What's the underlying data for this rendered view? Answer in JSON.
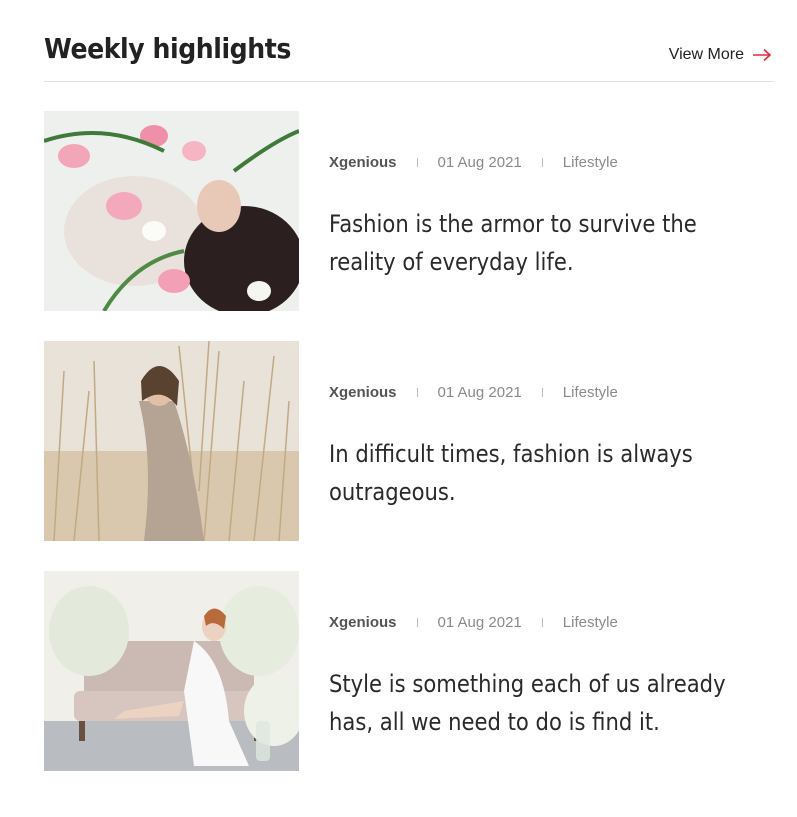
{
  "header": {
    "title": "Weekly highlights",
    "view_more_label": "View More",
    "accent_color": "#e02b3c"
  },
  "posts": [
    {
      "author": "Xgenious",
      "date": "01 Aug 2021",
      "category": "Lifestyle",
      "title": "Fashion is the armor to survive the reality of everyday life.",
      "image_icon": "woman-with-pink-flowers-photo"
    },
    {
      "author": "Xgenious",
      "date": "01 Aug 2021",
      "category": "Lifestyle",
      "title": "In difficult times, fashion is always outrageous.",
      "image_icon": "woman-in-dry-grass-field-photo"
    },
    {
      "author": "Xgenious",
      "date": "01 Aug 2021",
      "category": "Lifestyle",
      "title": "Style is something each of us already has, all we need to do is find it.",
      "image_icon": "woman-on-sofa-with-white-flowers-photo"
    }
  ]
}
